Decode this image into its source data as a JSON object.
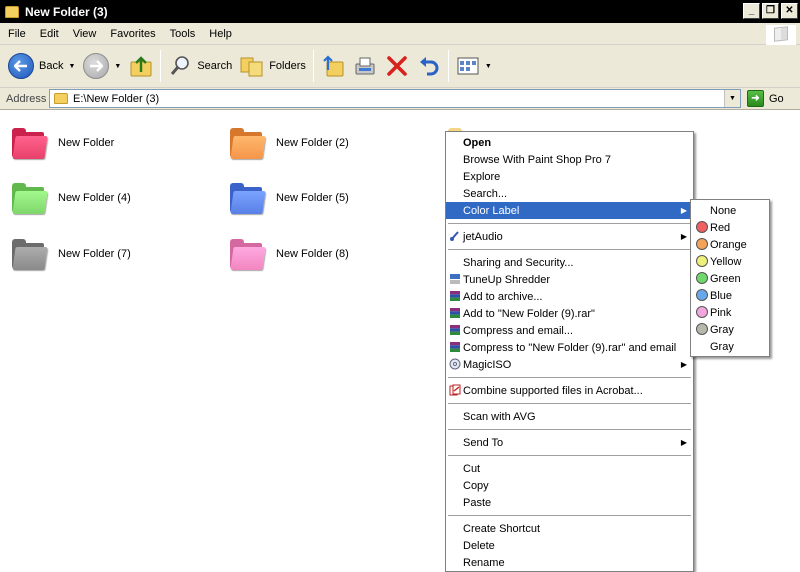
{
  "window": {
    "title": "New Folder (3)",
    "btn_min": "_",
    "btn_restore": "❐",
    "btn_close": "✕"
  },
  "menu": [
    "File",
    "Edit",
    "View",
    "Favorites",
    "Tools",
    "Help"
  ],
  "toolbar": {
    "back": "Back",
    "search": "Search",
    "folders": "Folders"
  },
  "address": {
    "label": "Address",
    "value": "E:\\New Folder (3)",
    "go": "Go"
  },
  "folders": [
    {
      "name": "New Folder",
      "color": "#e8406a"
    },
    {
      "name": "New Folder (2)",
      "color": "#f5954a"
    },
    {
      "name": "New Folder (4)",
      "color": "#7fd66b"
    },
    {
      "name": "New Folder (5)",
      "color": "#5880e6"
    },
    {
      "name": "New Folder (7)",
      "color": "#8a8a8a"
    },
    {
      "name": "New Folder (8)",
      "color": "#f286bf"
    }
  ],
  "context_menu": {
    "items": [
      "Open",
      "Browse With Paint Shop Pro 7",
      "Explore",
      "Search...",
      "Color Label",
      "jetAudio",
      "Sharing and Security...",
      "TuneUp Shredder",
      "Add to archive...",
      "Add to \"New Folder (9).rar\"",
      "Compress and email...",
      "Compress to \"New Folder (9).rar\" and email",
      "MagicISO",
      "Combine supported files in Acrobat...",
      "Scan with AVG",
      "Send To",
      "Cut",
      "Copy",
      "Paste",
      "Create Shortcut",
      "Delete",
      "Rename"
    ]
  },
  "color_label_submenu": [
    {
      "label": "None",
      "color": ""
    },
    {
      "label": "Red",
      "color": "#f06060"
    },
    {
      "label": "Orange",
      "color": "#f3a35a"
    },
    {
      "label": "Yellow",
      "color": "#eef07a"
    },
    {
      "label": "Green",
      "color": "#6fd86a"
    },
    {
      "label": "Blue",
      "color": "#68a8ec"
    },
    {
      "label": "Pink",
      "color": "#f2a6dc"
    },
    {
      "label": "Gray",
      "color": "#b8b8aa"
    },
    {
      "label": "Gray",
      "color": ""
    }
  ]
}
